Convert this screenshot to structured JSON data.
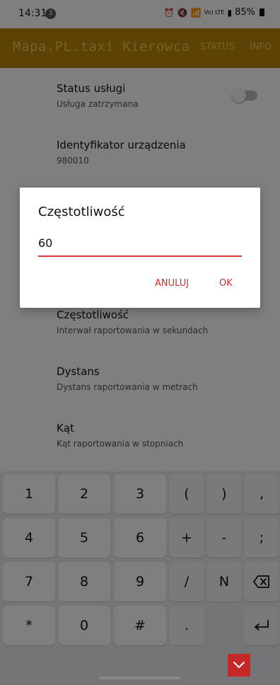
{
  "status_bar": {
    "time": "14:31",
    "notification_count": "3",
    "signal_text": "Vo) LTE",
    "battery": "85%"
  },
  "app_bar": {
    "title": "Mapa.PL.taxi Kierowca",
    "actions": [
      "STATUS",
      "INFO"
    ],
    "color": "#b8860b"
  },
  "preferences": [
    {
      "title": "Status usługi",
      "summary": "Usługa zatrzymana",
      "toggle_on": false
    },
    {
      "title": "Identyfikator urządzenia",
      "summary": "980010"
    },
    {
      "title": "Częstotliwość",
      "summary": "Interwał raportowania w sekundach"
    },
    {
      "title": "Dystans",
      "summary": "Dystans raportowania w metrach"
    },
    {
      "title": "Kąt",
      "summary": "Kąt raportowania w stopniach"
    }
  ],
  "dialog": {
    "title": "Częstotliwość",
    "input_value": "60",
    "cancel_label": "ANULUJ",
    "ok_label": "OK",
    "accent": "#d32f2f"
  },
  "keyboard": {
    "rows": [
      [
        "1",
        "2",
        "3",
        "(",
        ")",
        ","
      ],
      [
        "4",
        "5",
        "6",
        "+",
        "-",
        ";"
      ],
      [
        "7",
        "8",
        "9",
        "/",
        "N",
        "backspace-icon"
      ],
      [
        "*",
        "0",
        "#",
        ".",
        "",
        "enter-icon"
      ]
    ],
    "hide_icon": "chevron-down-icon"
  }
}
